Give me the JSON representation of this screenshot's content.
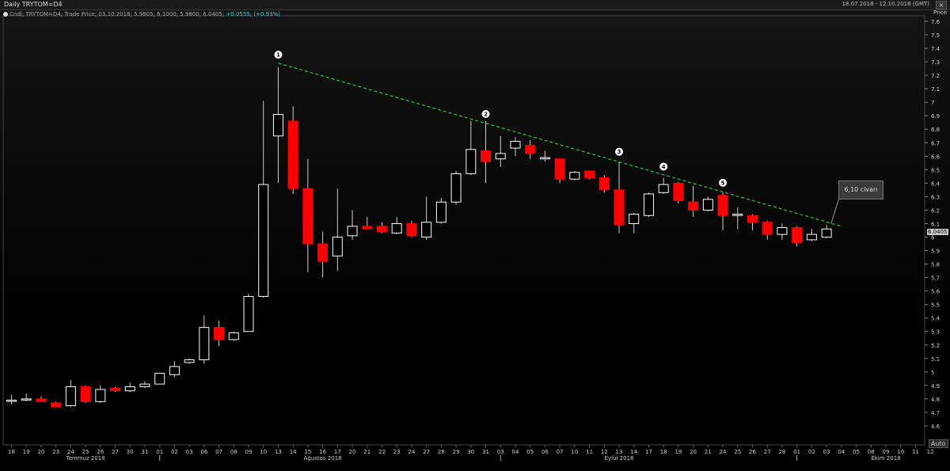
{
  "header": {
    "title": "Daily TRYTOM=D4",
    "date_range": "18.07.2018 - 12.10.2018 (GMT)",
    "close_label": "×"
  },
  "legend": {
    "text": "Cndl; TRYTOM=D4; Trade Price; 03.10.2018; 5.9805; 6.1000; 5.9800; 6.0405;",
    "change": "+0.0555; (+0.93%)"
  },
  "axis": {
    "price_label": "Price",
    "last_price": "6.0405",
    "auto_label": "Auto"
  },
  "annotation": {
    "text": "6,10 civarı"
  },
  "colors": {
    "up": "#ffffff",
    "down": "#ff0000",
    "trend": "#22cc44",
    "background": "#000000"
  },
  "chart_data": {
    "type": "candlestick",
    "ylim": [
      4.45,
      7.65
    ],
    "yticks": [
      4.6,
      4.7,
      4.8,
      4.9,
      5,
      5.1,
      5.2,
      5.3,
      5.4,
      5.5,
      5.6,
      5.7,
      5.8,
      5.9,
      6,
      6.1,
      6.2,
      6.3,
      6.4,
      6.5,
      6.6,
      6.7,
      6.8,
      6.9,
      7,
      7.1,
      7.2,
      7.3,
      7.4,
      7.5,
      7.6
    ],
    "x_labels": [
      "18",
      "19",
      "20",
      "23",
      "24",
      "25",
      "26",
      "27",
      "30",
      "31",
      "01",
      "02",
      "03",
      "06",
      "07",
      "08",
      "09",
      "10",
      "13",
      "14",
      "15",
      "16",
      "17",
      "20",
      "21",
      "22",
      "23",
      "24",
      "27",
      "28",
      "29",
      "30",
      "31",
      "03",
      "04",
      "05",
      "06",
      "07",
      "10",
      "11",
      "12",
      "13",
      "14",
      "17",
      "18",
      "19",
      "20",
      "21",
      "24",
      "25",
      "26",
      "27",
      "28",
      "01",
      "02",
      "03",
      "04",
      "05",
      "08",
      "09",
      "10",
      "11",
      "12"
    ],
    "months": [
      {
        "label": "Temmuz 2018",
        "at": "25"
      },
      {
        "label": "Ağustos 2018",
        "at": "15"
      },
      {
        "label": "Eylül 2018",
        "at": "13"
      },
      {
        "label": "Ekim 2018",
        "at": "05"
      }
    ],
    "month_separators": [
      "01",
      "03",
      "01"
    ],
    "candles": [
      {
        "o": 4.79,
        "h": 4.83,
        "l": 4.76,
        "c": 4.79
      },
      {
        "o": 4.8,
        "h": 4.84,
        "l": 4.78,
        "c": 4.8
      },
      {
        "o": 4.8,
        "h": 4.82,
        "l": 4.78,
        "c": 4.78
      },
      {
        "o": 4.77,
        "h": 4.78,
        "l": 4.74,
        "c": 4.74
      },
      {
        "o": 4.75,
        "h": 4.94,
        "l": 4.74,
        "c": 4.89
      },
      {
        "o": 4.89,
        "h": 4.9,
        "l": 4.77,
        "c": 4.78
      },
      {
        "o": 4.78,
        "h": 4.9,
        "l": 4.77,
        "c": 4.87
      },
      {
        "o": 4.88,
        "h": 4.89,
        "l": 4.85,
        "c": 4.86
      },
      {
        "o": 4.86,
        "h": 4.92,
        "l": 4.85,
        "c": 4.89
      },
      {
        "o": 4.89,
        "h": 4.93,
        "l": 4.88,
        "c": 4.91
      },
      {
        "o": 4.91,
        "h": 4.99,
        "l": 4.91,
        "c": 4.99
      },
      {
        "o": 4.98,
        "h": 5.08,
        "l": 4.96,
        "c": 5.04
      },
      {
        "o": 5.07,
        "h": 5.1,
        "l": 5.06,
        "c": 5.09
      },
      {
        "o": 5.09,
        "h": 5.42,
        "l": 5.06,
        "c": 5.33
      },
      {
        "o": 5.33,
        "h": 5.38,
        "l": 5.19,
        "c": 5.24
      },
      {
        "o": 5.24,
        "h": 5.3,
        "l": 5.23,
        "c": 5.29
      },
      {
        "o": 5.3,
        "h": 5.58,
        "l": 5.3,
        "c": 5.56
      },
      {
        "o": 5.56,
        "h": 7.01,
        "l": 5.55,
        "c": 6.39
      },
      {
        "o": 6.75,
        "h": 7.26,
        "l": 6.4,
        "c": 6.91
      },
      {
        "o": 6.86,
        "h": 6.97,
        "l": 6.32,
        "c": 6.36
      },
      {
        "o": 6.36,
        "h": 6.58,
        "l": 5.74,
        "c": 5.95
      },
      {
        "o": 5.95,
        "h": 6.04,
        "l": 5.7,
        "c": 5.82
      },
      {
        "o": 5.86,
        "h": 6.36,
        "l": 5.75,
        "c": 6.0
      },
      {
        "o": 6.01,
        "h": 6.2,
        "l": 5.98,
        "c": 6.08
      },
      {
        "o": 6.08,
        "h": 6.15,
        "l": 6.06,
        "c": 6.06
      },
      {
        "o": 6.08,
        "h": 6.11,
        "l": 6.03,
        "c": 6.04
      },
      {
        "o": 6.03,
        "h": 6.15,
        "l": 6.02,
        "c": 6.1
      },
      {
        "o": 6.1,
        "h": 6.12,
        "l": 6.0,
        "c": 6.01
      },
      {
        "o": 6.0,
        "h": 6.3,
        "l": 5.98,
        "c": 6.11
      },
      {
        "o": 6.11,
        "h": 6.29,
        "l": 6.1,
        "c": 6.26
      },
      {
        "o": 6.26,
        "h": 6.49,
        "l": 6.24,
        "c": 6.47
      },
      {
        "o": 6.47,
        "h": 6.86,
        "l": 6.46,
        "c": 6.65
      },
      {
        "o": 6.64,
        "h": 6.86,
        "l": 6.4,
        "c": 6.56
      },
      {
        "o": 6.58,
        "h": 6.75,
        "l": 6.52,
        "c": 6.62
      },
      {
        "o": 6.66,
        "h": 6.74,
        "l": 6.6,
        "c": 6.71
      },
      {
        "o": 6.68,
        "h": 6.72,
        "l": 6.58,
        "c": 6.62
      },
      {
        "o": 6.58,
        "h": 6.64,
        "l": 6.56,
        "c": 6.59
      },
      {
        "o": 6.58,
        "h": 6.58,
        "l": 6.4,
        "c": 6.43
      },
      {
        "o": 6.43,
        "h": 6.49,
        "l": 6.42,
        "c": 6.48
      },
      {
        "o": 6.49,
        "h": 6.49,
        "l": 6.43,
        "c": 6.44
      },
      {
        "o": 6.44,
        "h": 6.46,
        "l": 6.33,
        "c": 6.35
      },
      {
        "o": 6.35,
        "h": 6.56,
        "l": 6.03,
        "c": 6.09
      },
      {
        "o": 6.1,
        "h": 6.18,
        "l": 6.03,
        "c": 6.17
      },
      {
        "o": 6.16,
        "h": 6.33,
        "l": 6.15,
        "c": 6.32
      },
      {
        "o": 6.33,
        "h": 6.44,
        "l": 6.32,
        "c": 6.39
      },
      {
        "o": 6.4,
        "h": 6.41,
        "l": 6.25,
        "c": 6.27
      },
      {
        "o": 6.26,
        "h": 6.38,
        "l": 6.15,
        "c": 6.2
      },
      {
        "o": 6.2,
        "h": 6.3,
        "l": 6.19,
        "c": 6.28
      },
      {
        "o": 6.31,
        "h": 6.33,
        "l": 6.05,
        "c": 6.16
      },
      {
        "o": 6.16,
        "h": 6.22,
        "l": 6.06,
        "c": 6.17
      },
      {
        "o": 6.16,
        "h": 6.17,
        "l": 6.05,
        "c": 6.11
      },
      {
        "o": 6.11,
        "h": 6.12,
        "l": 5.98,
        "c": 6.02
      },
      {
        "o": 6.02,
        "h": 6.1,
        "l": 5.98,
        "c": 6.07
      },
      {
        "o": 6.07,
        "h": 6.08,
        "l": 5.93,
        "c": 5.96
      },
      {
        "o": 5.98,
        "h": 6.06,
        "l": 5.97,
        "c": 6.02
      },
      {
        "o": 6.0,
        "h": 6.09,
        "l": 5.99,
        "c": 6.06
      }
    ],
    "trendline": {
      "from": {
        "x": "13",
        "y": 7.29
      },
      "to": {
        "x": "05",
        "y": 6.08
      }
    },
    "markers": [
      {
        "label": "1",
        "at": "13",
        "y": 7.3
      },
      {
        "label": "2",
        "at": "31",
        "y": 6.86
      },
      {
        "label": "3",
        "at": "13b",
        "y": 6.58
      },
      {
        "label": "4",
        "at": "18",
        "y": 6.47
      },
      {
        "label": "5",
        "at": "24b",
        "y": 6.35
      }
    ]
  }
}
